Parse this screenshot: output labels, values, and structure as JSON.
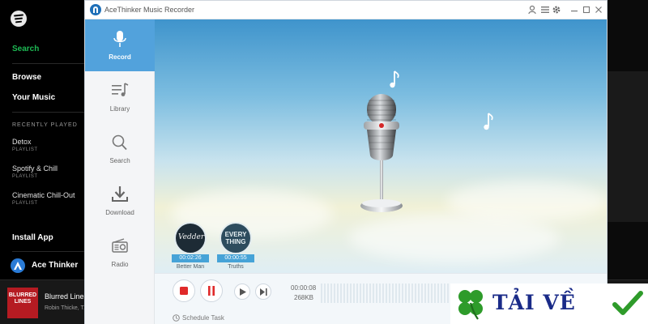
{
  "spotify": {
    "nav": {
      "search": "Search",
      "browse": "Browse",
      "your_music": "Your Music"
    },
    "recently_played_heading": "RECENTLY PLAYED",
    "playlists": [
      {
        "name": "Detox",
        "type": "PLAYLIST"
      },
      {
        "name": "Spotify & Chill",
        "type": "PLAYLIST"
      },
      {
        "name": "Cinematic Chill-Out",
        "type": "PLAYLIST"
      }
    ],
    "install_app": "Install App",
    "ace_thinker": "Ace Thinker",
    "now_playing": {
      "track": "Blurred Lines",
      "artist": "Robin Thicke, T.",
      "cover_text": "BLURRED LINES"
    },
    "colors": {
      "accent": "#1db954"
    }
  },
  "app": {
    "title": "AceThinker Music Recorder",
    "nav": [
      {
        "label": "Record",
        "icon": "microphone-icon"
      },
      {
        "label": "Library",
        "icon": "playlist-icon"
      },
      {
        "label": "Search",
        "icon": "search-icon"
      },
      {
        "label": "Download",
        "icon": "download-icon"
      },
      {
        "label": "Radio",
        "icon": "radio-icon"
      }
    ],
    "recordings": [
      {
        "time": "00:02:26",
        "name": "Better Man",
        "cover_text": "Vedder"
      },
      {
        "time": "00:00:55",
        "name": "Truths",
        "cover_text": "EVERY THING"
      }
    ],
    "status": {
      "time": "00:00:08",
      "size": "268KB"
    },
    "schedule_task": "Schedule Task",
    "colors": {
      "accent": "#52a2dc",
      "record": "#e02a2a"
    }
  },
  "watermark": {
    "text": "TẢI VỀ"
  }
}
